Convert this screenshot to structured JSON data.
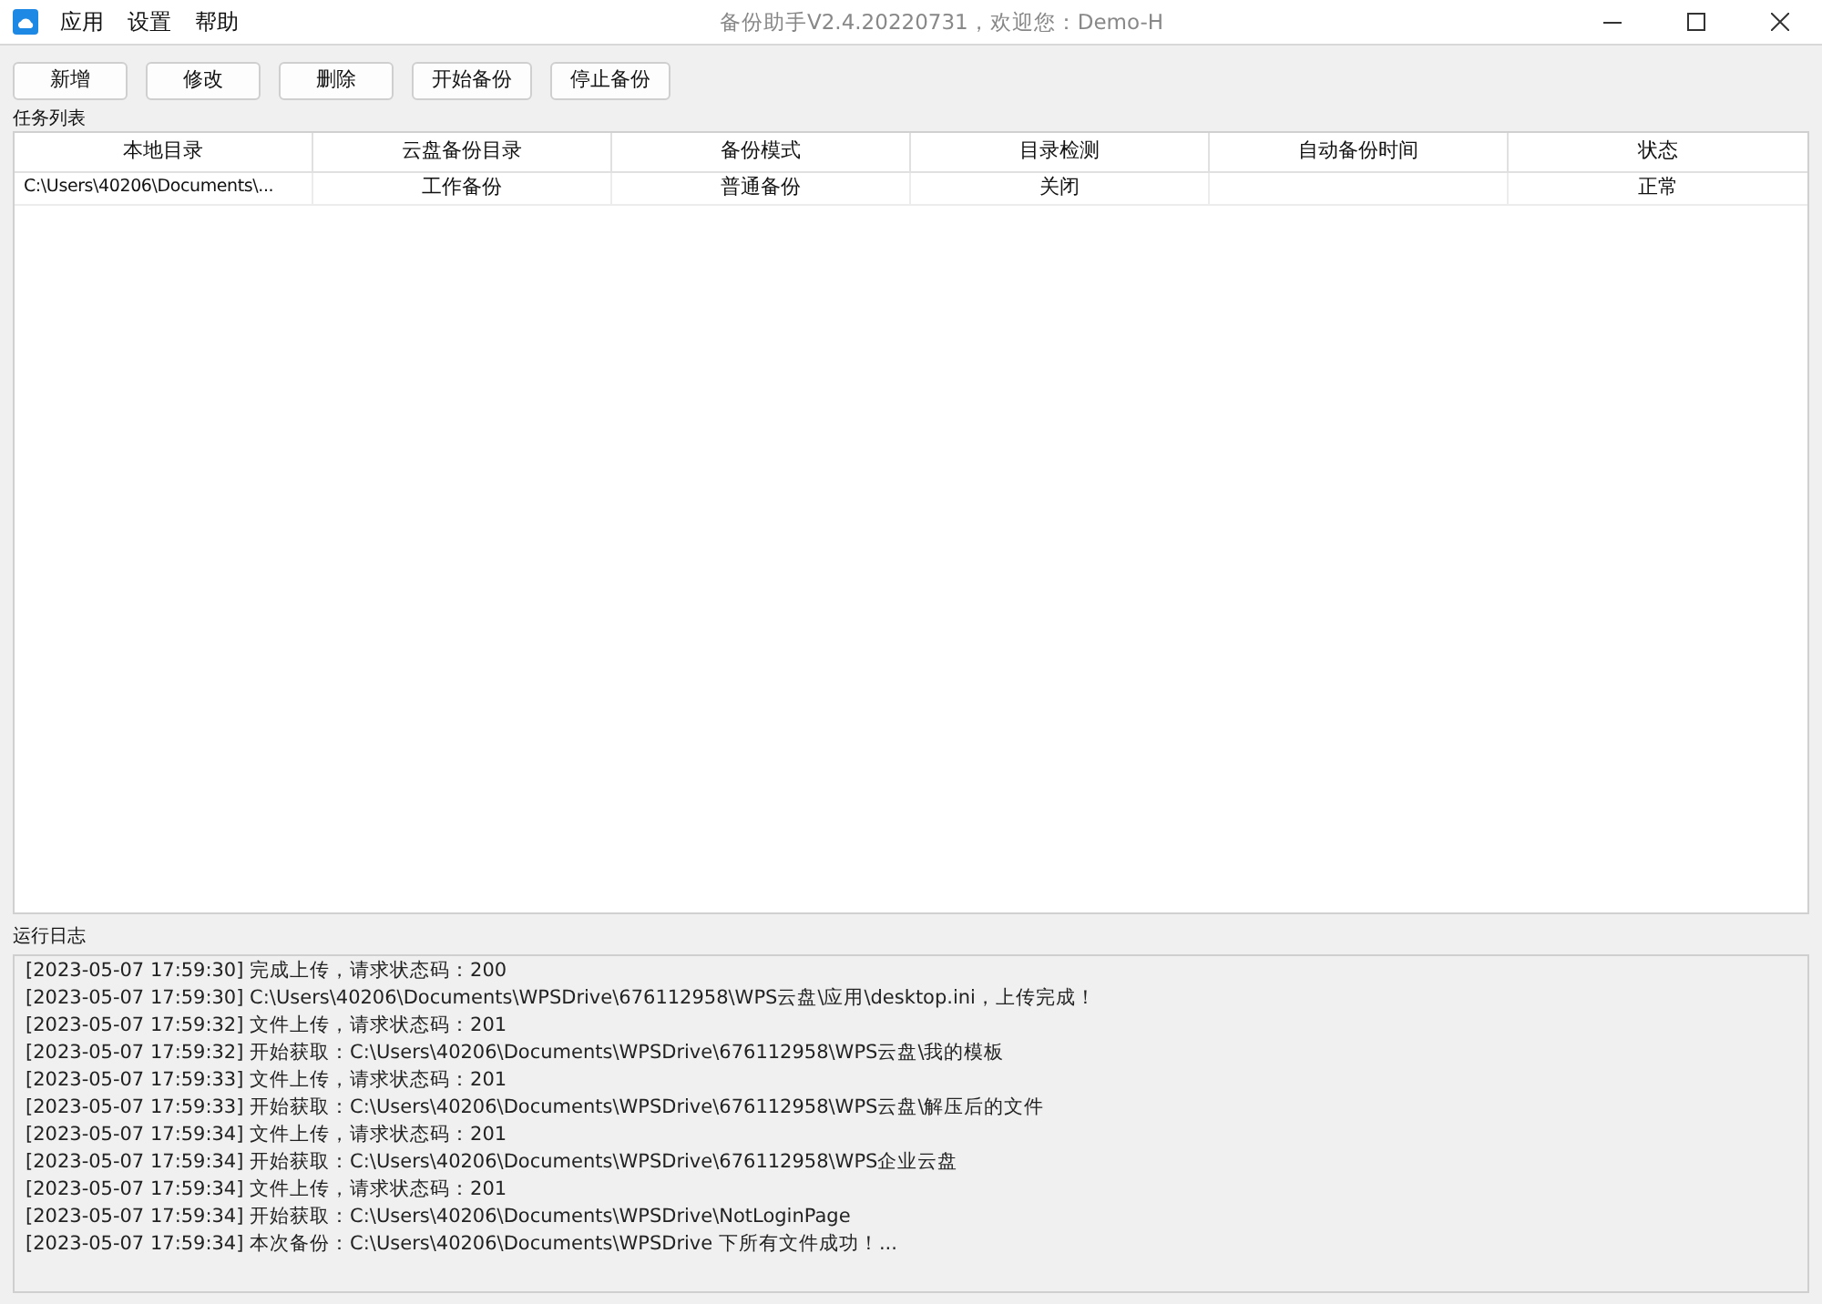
{
  "menu": [
    "应用",
    "设置",
    "帮助"
  ],
  "window": {
    "title": "备份助手V2.4.20220731，欢迎您：Demo-H"
  },
  "toolbar": [
    "新增",
    "修改",
    "删除",
    "开始备份",
    "停止备份"
  ],
  "task_list": {
    "label": "任务列表",
    "columns": [
      "本地目录",
      "云盘备份目录",
      "备份模式",
      "目录检测",
      "自动备份时间",
      "状态"
    ],
    "rows": [
      [
        "C:\\Users\\40206\\Documents\\...",
        "工作备份",
        "普通备份",
        "关闭",
        "",
        "正常"
      ]
    ]
  },
  "log": {
    "label": "运行日志",
    "lines": [
      "[2023-05-07 17:59:30] 完成上传，请求状态码：200",
      "[2023-05-07 17:59:30] C:\\Users\\40206\\Documents\\WPSDrive\\676112958\\WPS云盘\\应用\\desktop.ini，上传完成！",
      "[2023-05-07 17:59:32] 文件上传，请求状态码：201",
      "[2023-05-07 17:59:32] 开始获取：C:\\Users\\40206\\Documents\\WPSDrive\\676112958\\WPS云盘\\我的模板",
      "[2023-05-07 17:59:33] 文件上传，请求状态码：201",
      "[2023-05-07 17:59:33] 开始获取：C:\\Users\\40206\\Documents\\WPSDrive\\676112958\\WPS云盘\\解压后的文件",
      "[2023-05-07 17:59:34] 文件上传，请求状态码：201",
      "[2023-05-07 17:59:34] 开始获取：C:\\Users\\40206\\Documents\\WPSDrive\\676112958\\WPS企业云盘",
      "[2023-05-07 17:59:34] 文件上传，请求状态码：201",
      "[2023-05-07 17:59:34] 开始获取：C:\\Users\\40206\\Documents\\WPSDrive\\NotLoginPage",
      "[2023-05-07 17:59:34] 本次备份：C:\\Users\\40206\\Documents\\WPSDrive 下所有文件成功！..."
    ]
  }
}
